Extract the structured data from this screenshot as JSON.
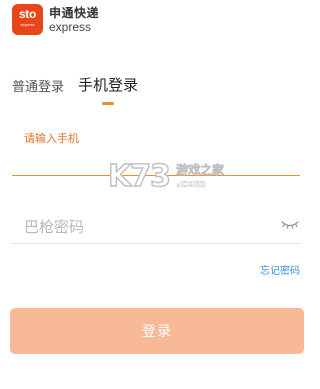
{
  "brand": {
    "logo_text": "sto",
    "logo_sub": "express",
    "name_cn": "申通快递",
    "name_en": "express",
    "color": "#e8461a"
  },
  "tabs": [
    {
      "label": "普通登录",
      "active": false
    },
    {
      "label": "手机登录",
      "active": true
    }
  ],
  "phone_field": {
    "label": "请输入手机",
    "value": "",
    "placeholder": ""
  },
  "password_field": {
    "value": "",
    "placeholder": "巴枪密码"
  },
  "icons": {
    "eye": "eye-closed-icon"
  },
  "watermark": {
    "logo": "K73",
    "text_cn": "游戏之家",
    "text_en": ".com"
  },
  "links": {
    "forgot_password": "忘记密码"
  },
  "login_button": {
    "label": "登录",
    "color": "#f7b996"
  },
  "accent_color": "#f08a2b"
}
